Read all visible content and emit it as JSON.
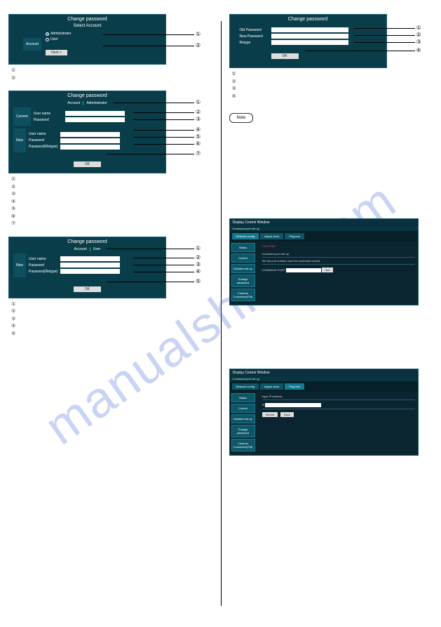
{
  "watermark": "manualshive.com",
  "panels": {
    "p1": {
      "title": "Change password",
      "sub": "Select Account",
      "account_label": "Account",
      "opt_admin": "Administrator",
      "opt_user": "User",
      "next": "Next >"
    },
    "p2": {
      "title": "Change password",
      "acct_label": "Account",
      "acct_val": "Administrator",
      "current": "Current",
      "new": "New",
      "user_name": "User name",
      "password": "Password",
      "password_retype": "Password(Retype)",
      "ok": "OK"
    },
    "p3": {
      "title": "Change password",
      "acct_label": "Account",
      "acct_val": "User",
      "new": "New",
      "user_name": "User name",
      "password": "Password",
      "password_retype": "Password(Retype)",
      "ok": "OK"
    },
    "p4": {
      "title": "Change password",
      "old_password": "Old Password",
      "new_password": "New Password",
      "retype": "Retype",
      "ok": "OK"
    }
  },
  "lists": {
    "l1": [
      "①",
      "②"
    ],
    "l2": [
      "①",
      "②",
      "③",
      "④",
      "⑤",
      "⑥",
      "⑦"
    ],
    "l3": [
      "①",
      "②",
      "③",
      "④",
      "⑤"
    ],
    "l4": [
      "①",
      "②",
      "③",
      "④"
    ]
  },
  "note": "Note",
  "big1": {
    "win": "Display Control Window",
    "sub": "Command port set up",
    "tabs": [
      "Network config",
      "Adjust clock",
      "Ping test"
    ],
    "side": [
      "Status",
      "Control",
      "Detailed set up",
      "Change password",
      "Crestron Connected(TM)"
    ],
    "warn": "CAUTION!",
    "text1": "Command port set up",
    "text2": "Set the port number used for command control.",
    "cmd_port": "COMMAND PORT",
    "set": "Set"
  },
  "big2": {
    "win": "Display Control Window",
    "sub": "Command port set up",
    "tabs": [
      "Network config",
      "Adjust clock",
      "Ping test"
    ],
    "side": [
      "Status",
      "Control",
      "Detailed set up",
      "Change password",
      "Crestron Connected(TM)"
    ],
    "ip_label": "Input IP address",
    "ip": "IP",
    "submit": "Submit",
    "back": "Back"
  },
  "callouts": {
    "c1": [
      "①",
      "②"
    ],
    "c2": [
      "①",
      "②",
      "③",
      "④",
      "⑤",
      "⑥",
      "⑦"
    ],
    "c3": [
      "①",
      "②",
      "③",
      "④",
      "⑤"
    ],
    "c4": [
      "①",
      "②",
      "③",
      "④"
    ]
  }
}
